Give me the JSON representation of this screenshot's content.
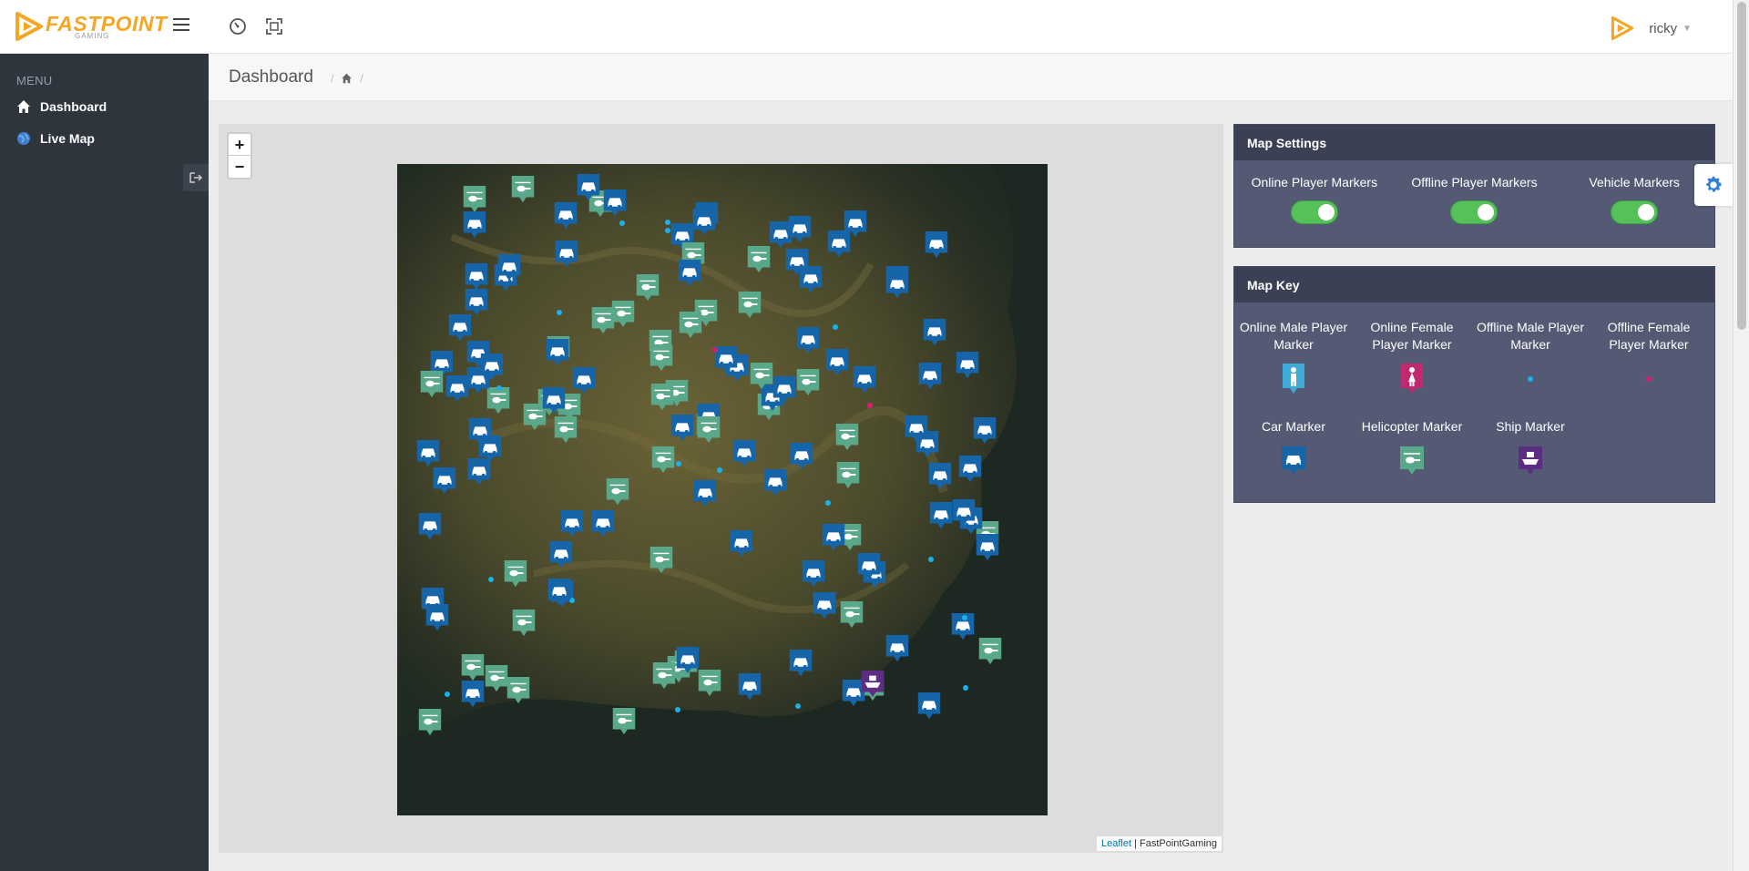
{
  "header": {
    "logo_text": "FASTPOINT",
    "logo_subtext": "GAMING",
    "user_name": "ricky"
  },
  "sidebar": {
    "menu_label": "MENU",
    "items": [
      {
        "label": "Dashboard",
        "icon": "home-icon"
      },
      {
        "label": "Live Map",
        "icon": "globe-icon"
      }
    ]
  },
  "breadcrumb": {
    "title": "Dashboard"
  },
  "map": {
    "zoom_in": "+",
    "zoom_out": "−",
    "attribution_link": "Leaflet",
    "attribution_text": " | FastPointGaming"
  },
  "map_settings": {
    "title": "Map Settings",
    "toggles": [
      {
        "label": "Online Player Markers",
        "on": true
      },
      {
        "label": "Offline Player Markers",
        "on": true
      },
      {
        "label": "Vehicle Markers",
        "on": true
      }
    ]
  },
  "map_key": {
    "title": "Map Key",
    "items": [
      {
        "label": "Online Male Player Marker",
        "icon": "male-player-marker-icon",
        "color": "#3fa9d8"
      },
      {
        "label": "Online Female Player Marker",
        "icon": "female-player-marker-icon",
        "color": "#c2286f"
      },
      {
        "label": "Offline Male Player Marker",
        "icon": "offline-male-dot-icon",
        "color": "#1ab2e8"
      },
      {
        "label": "Offline Female Player Marker",
        "icon": "offline-female-dot-icon",
        "color": "#d61e72"
      },
      {
        "label": "Car Marker",
        "icon": "car-marker-icon",
        "color": "#1565a8"
      },
      {
        "label": "Helicopter Marker",
        "icon": "helicopter-marker-icon",
        "color": "#5aa88a"
      },
      {
        "label": "Ship Marker",
        "icon": "ship-marker-icon",
        "color": "#5c2d82"
      }
    ]
  },
  "colors": {
    "brand": "#f5a623",
    "sidebar": "#2f353d",
    "panel": "#545a73",
    "toggle_on": "#56c159"
  }
}
